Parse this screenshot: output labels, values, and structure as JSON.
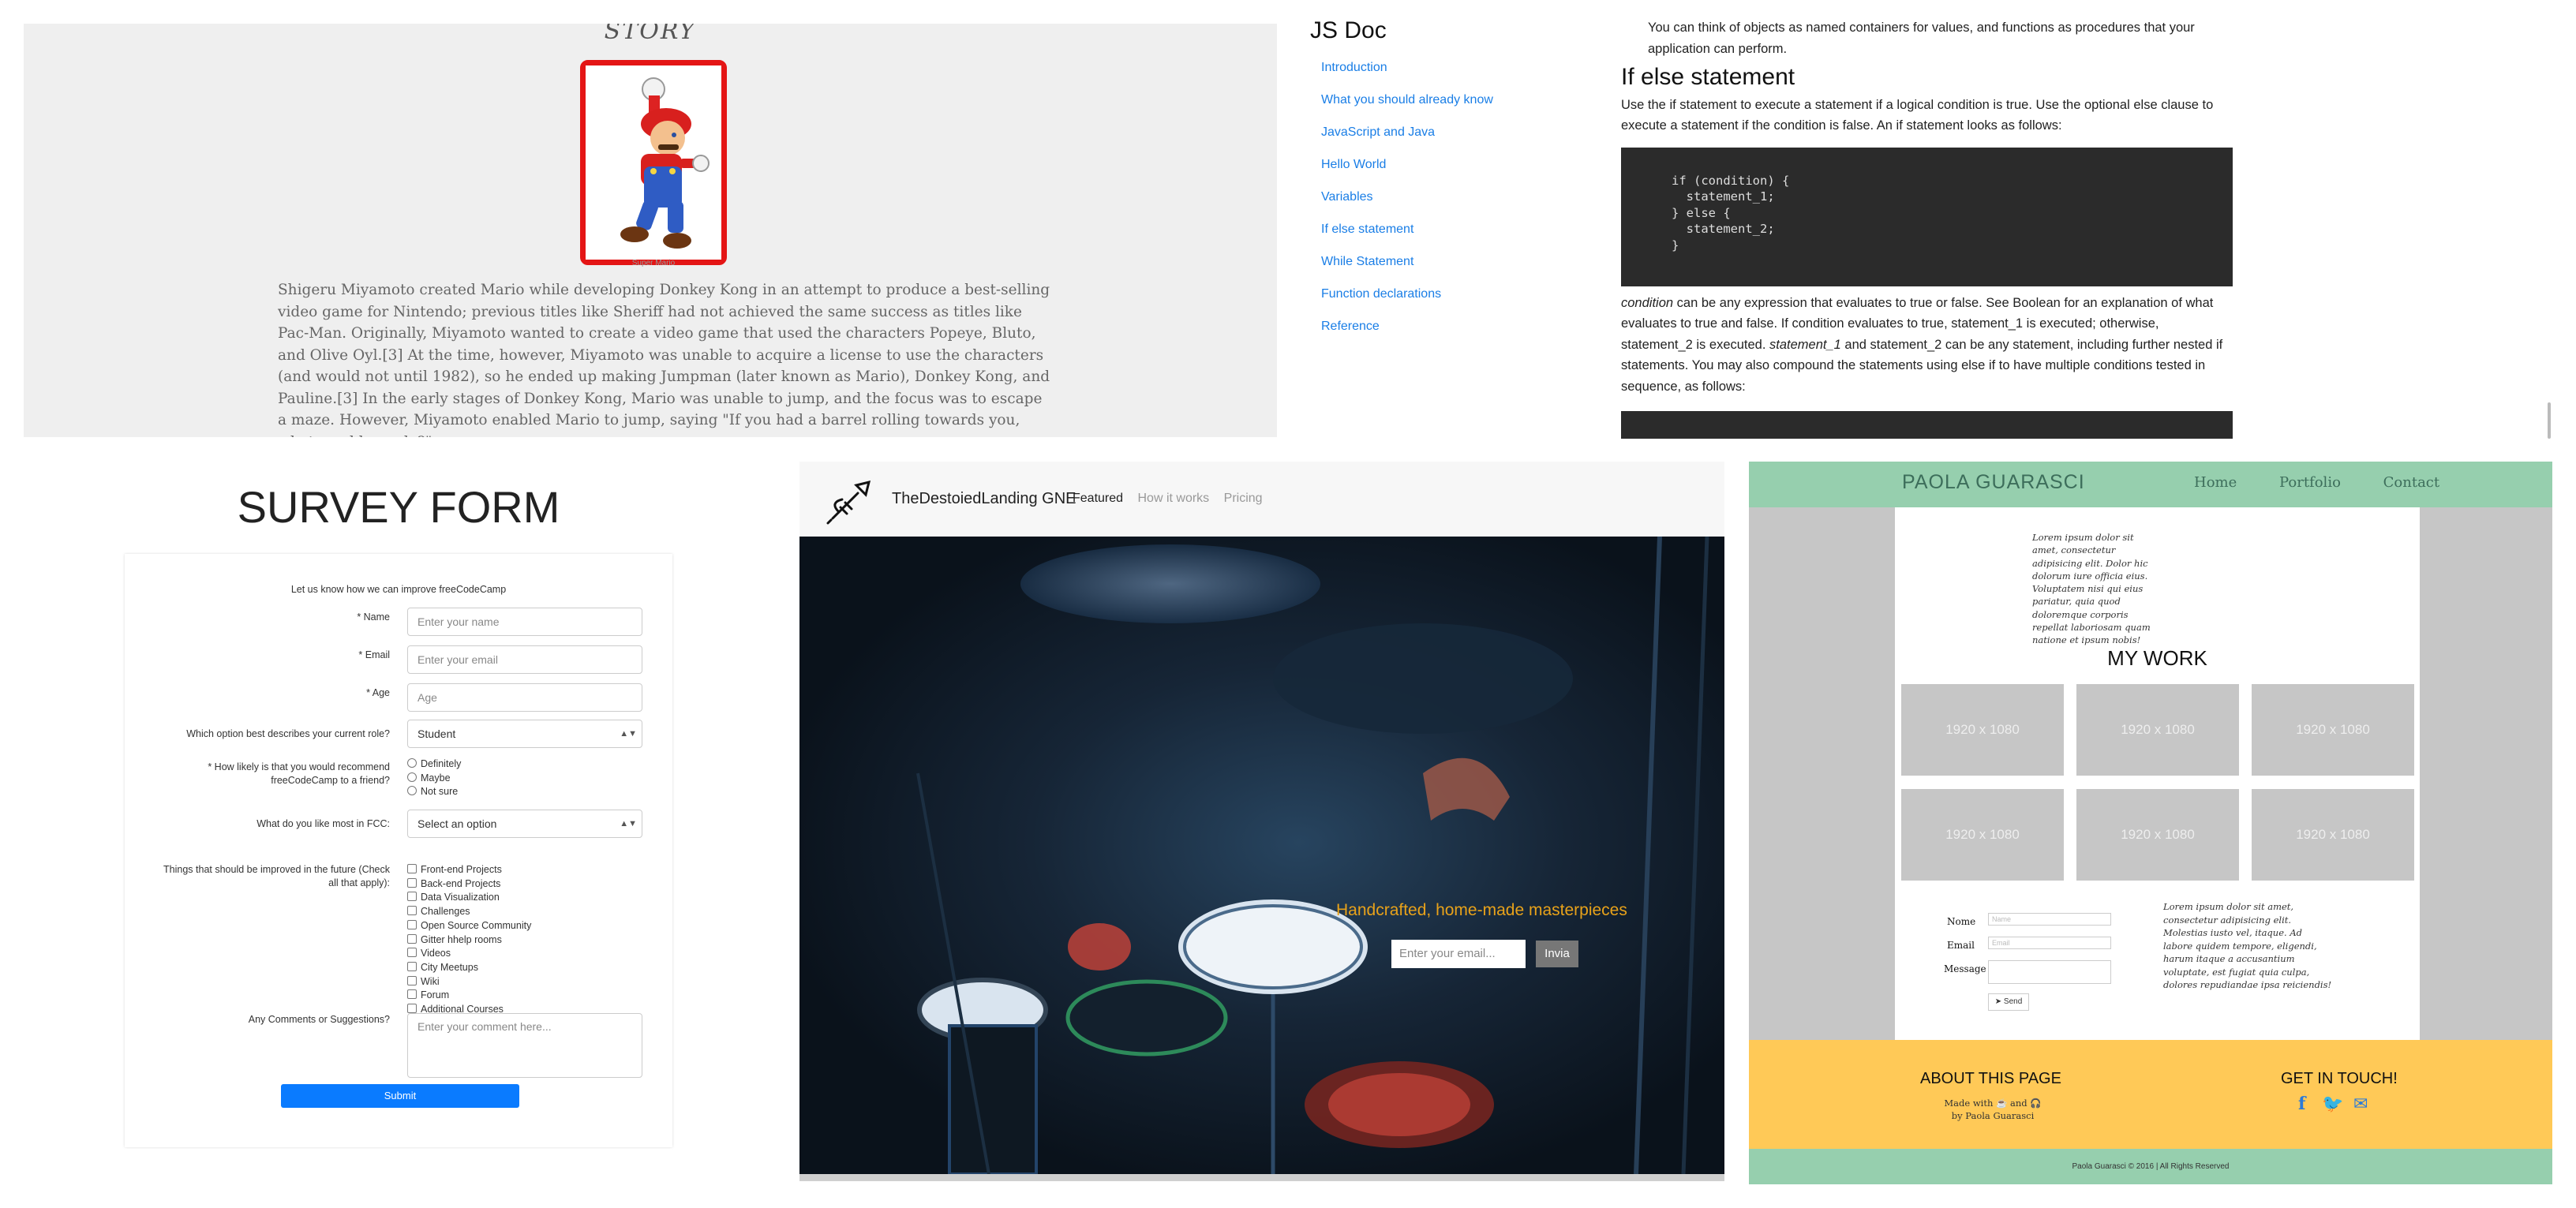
{
  "mario": {
    "heading": "STORY",
    "image_caption": "Super Mario",
    "story": "Shigeru Miyamoto created Mario while developing Donkey Kong in an attempt to produce a best-selling video game for Nintendo; previous titles like Sheriff had not achieved the same success as titles like Pac-Man. Originally, Miyamoto wanted to create a video game that used the characters Popeye, Bluto, and Olive Oyl.[3] At the time, however, Miyamoto was unable to acquire a license to use the characters (and would not until 1982), so he ended up making Jumpman (later known as Mario), Donkey Kong, and Pauline.[3] In the early stages of Donkey Kong, Mario was unable to jump, and the focus was to escape a maze. However, Miyamoto enabled Mario to jump, saying \"If you had a barrel rolling towards you, what would you do?\""
  },
  "jsdoc": {
    "title": "JS Doc",
    "nav": [
      "Introduction",
      "What you should already know",
      "JavaScript and Java",
      "Hello World",
      "Variables",
      "If else statement",
      "While Statement",
      "Function declarations",
      "Reference"
    ],
    "intro": "You can think of objects as named containers for values, and functions as procedures that your application can perform.",
    "section_title": "If else statement",
    "section_p1": "Use the if statement to execute a statement if a logical condition is true. Use the optional else clause to execute a statement if the condition is false. An if statement looks as follows:",
    "code": "if (condition) {\n  statement_1;\n} else {\n  statement_2;\n}",
    "section_p2_em": "condition",
    "section_p2_a": " can be any expression that evaluates to true or false. See Boolean for an explanation of what evaluates to true and false. If condition evaluates to true, statement_1 is executed; otherwise, statement_2 is executed. ",
    "section_p2_em2": "statement_1",
    "section_p2_b": " and statement_2 can be any statement, including further nested if statements. You may also compound the statements using else if to have multiple conditions tested in sequence, as follows:"
  },
  "survey": {
    "title": "SURVEY FORM",
    "description": "Let us know how we can improve freeCodeCamp",
    "name_label": "* Name",
    "name_placeholder": "Enter your name",
    "email_label": "* Email",
    "email_placeholder": "Enter your email",
    "age_label": "* Age",
    "age_placeholder": "Age",
    "role_label": "Which option best describes your current role?",
    "role_value": "Student",
    "recommend_label": "* How likely is that you would recommend freeCodeCamp to a friend?",
    "recommend_options": [
      "Definitely",
      "Maybe",
      "Not sure"
    ],
    "like_label": "What do you like most in FCC:",
    "like_value": "Select an option",
    "improve_label": "Things that should be improved in the future (Check all that apply):",
    "improve_options": [
      "Front-end Projects",
      "Back-end Projects",
      "Data Visualization",
      "Challenges",
      "Open Source Community",
      "Gitter hhelp rooms",
      "Videos",
      "City Meetups",
      "Wiki",
      "Forum",
      "Additional Courses"
    ],
    "comments_label": "Any Comments or Suggestions?",
    "comments_placeholder": "Enter your comment here...",
    "submit": "Submit"
  },
  "landing": {
    "brand": "TheDestoiedLanding GNE",
    "nav": [
      "Featured",
      "How it works",
      "Pricing"
    ],
    "tagline": "Handcrafted, home-made masterpieces",
    "email_placeholder": "Enter your email...",
    "button": "Invia",
    "colors": {
      "tagline": "#e8a21a",
      "button": "#777777"
    }
  },
  "paola": {
    "brand": "PAOLA GUARASCI",
    "nav": [
      "Home",
      "Portfolio",
      "Contact"
    ],
    "about_text": "Lorem ipsum dolor sit amet, consectetur adipisicing elit. Dolor hic dolorum iure officia eius. Voluptatem nisi qui eius pariatur, quia quod doloremque corporis repellat laboriosam quam natione et ipsum nobis!",
    "mywork_title": "MY WORK",
    "thumbs": [
      "1920 x 1080",
      "1920 x 1080",
      "1920 x 1080",
      "1920 x 1080",
      "1920 x 1080",
      "1920 x 1080"
    ],
    "form": {
      "name_label": "Nome",
      "name_placeholder": "Name",
      "email_label": "Email",
      "email_placeholder": "Email",
      "message_label": "Message",
      "send": "Send"
    },
    "side_text": "Lorem ipsum dolor sit amet, consectetur adipisicing elit. Molestias iusto vel, itaque. Ad labore quidem tempore, eligendi, harum itaque a accusantium voluptate, est fugiat quia culpa, dolores repudiandae ipsa reiciendis!",
    "footer": {
      "about_title": "ABOUT THIS PAGE",
      "made_line1": "Made with ☕ and 🎧",
      "made_line2": "by Paola Guarasci",
      "touch_title": "GET IN TOUCH!",
      "social": [
        "f",
        "🐦",
        "✉"
      ]
    },
    "copyright": "Paola Guarasci © 2016 | All Rights Reserved",
    "colors": {
      "header": "#96cfae",
      "footer": "#ffc957"
    }
  }
}
